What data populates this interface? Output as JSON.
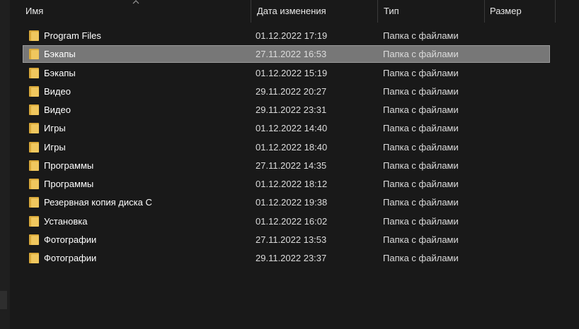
{
  "columns": {
    "name": "Имя",
    "date": "Дата изменения",
    "type": "Тип",
    "size": "Размер"
  },
  "selected_index": 1,
  "folder_color": "#f0c75e",
  "rows": [
    {
      "name": "Program Files",
      "date": "01.12.2022 17:19",
      "type": "Папка с файлами",
      "icon": "folder-icon"
    },
    {
      "name": "Бэкапы",
      "date": "27.11.2022 16:53",
      "type": "Папка с файлами",
      "icon": "folder-icon"
    },
    {
      "name": "Бэкапы",
      "date": "01.12.2022 15:19",
      "type": "Папка с файлами",
      "icon": "folder-icon"
    },
    {
      "name": "Видео",
      "date": "29.11.2022 20:27",
      "type": "Папка с файлами",
      "icon": "folder-icon"
    },
    {
      "name": "Видео",
      "date": "29.11.2022 23:31",
      "type": "Папка с файлами",
      "icon": "folder-icon"
    },
    {
      "name": "Игры",
      "date": "01.12.2022 14:40",
      "type": "Папка с файлами",
      "icon": "folder-icon"
    },
    {
      "name": "Игры",
      "date": "01.12.2022 18:40",
      "type": "Папка с файлами",
      "icon": "folder-icon"
    },
    {
      "name": "Программы",
      "date": "27.11.2022 14:35",
      "type": "Папка с файлами",
      "icon": "folder-icon"
    },
    {
      "name": "Программы",
      "date": "01.12.2022 18:12",
      "type": "Папка с файлами",
      "icon": "folder-icon"
    },
    {
      "name": "Резервная копия диска C",
      "date": "01.12.2022 19:38",
      "type": "Папка с файлами",
      "icon": "folder-icon"
    },
    {
      "name": "Установка",
      "date": "01.12.2022 16:02",
      "type": "Папка с файлами",
      "icon": "folder-icon"
    },
    {
      "name": "Фотографии",
      "date": "27.11.2022 13:53",
      "type": "Папка с файлами",
      "icon": "folder-icon"
    },
    {
      "name": "Фотографии",
      "date": "29.11.2022 23:37",
      "type": "Папка с файлами",
      "icon": "folder-icon"
    }
  ]
}
